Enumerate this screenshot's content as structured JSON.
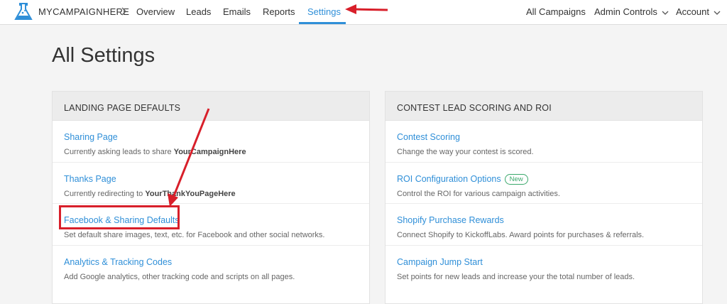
{
  "nav": {
    "brand": "MYCAMPAIGNHERE",
    "items": [
      {
        "label": "Overview"
      },
      {
        "label": "Leads"
      },
      {
        "label": "Emails"
      },
      {
        "label": "Reports"
      },
      {
        "label": "Settings",
        "active": true
      }
    ],
    "right": [
      {
        "label": "All Campaigns"
      },
      {
        "label": "Admin Controls"
      },
      {
        "label": "Account"
      }
    ]
  },
  "page": {
    "title": "All Settings"
  },
  "panels": {
    "left": {
      "title": "LANDING PAGE DEFAULTS",
      "rows": [
        {
          "title": "Sharing Page",
          "desc_prefix": "Currently asking leads to share ",
          "desc_bold": "YourCampaignHere"
        },
        {
          "title": "Thanks Page",
          "desc_prefix": "Currently redirecting to ",
          "desc_bold": "YourThankYouPageHere"
        },
        {
          "title": "Facebook & Sharing Defaults",
          "desc": "Set default share images, text, etc. for Facebook and other social networks."
        },
        {
          "title": "Analytics & Tracking Codes",
          "desc": "Add Google analytics, other tracking code and scripts on all pages."
        }
      ]
    },
    "right": {
      "title": "CONTEST LEAD SCORING AND ROI",
      "rows": [
        {
          "title": "Contest Scoring",
          "desc": "Change the way your contest is scored."
        },
        {
          "title": "ROI Configuration Options",
          "badge": "New",
          "desc": "Control the ROI for various campaign activities."
        },
        {
          "title": "Shopify Purchase Rewards",
          "desc": "Connect Shopify to KickoffLabs. Award points for purchases & referrals."
        },
        {
          "title": "Campaign Jump Start",
          "desc": "Set points for new leads and increase your the total number of leads."
        }
      ]
    }
  },
  "colors": {
    "accent": "#2f8fd8",
    "annotation": "#d81f2a",
    "badge": "#3aa86b"
  }
}
